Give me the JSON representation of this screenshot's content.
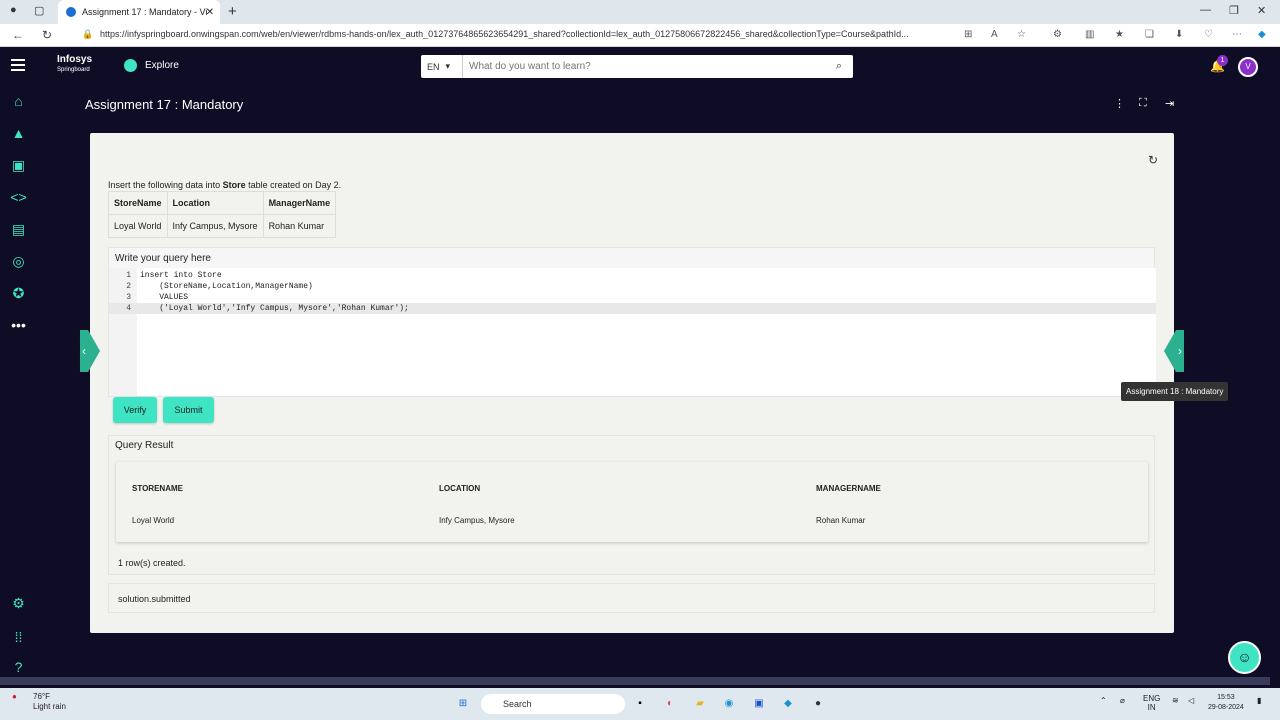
{
  "browser": {
    "tab_title": "Assignment 17 : Mandatory - Vi",
    "url": "https://infyspringboard.onwingspan.com/web/en/viewer/rdbms-hands-on/lex_auth_01273764865623654291_shared?collectionId=lex_auth_01275806672822456_shared&collectionType=Course&pathId..."
  },
  "header": {
    "logo_line1": "Infosys",
    "logo_line2": "Springboard",
    "explore_label": "Explore",
    "lang": "EN",
    "search_placeholder": "What do you want to learn?",
    "notification_count": "1",
    "avatar_initial": "V"
  },
  "page": {
    "title": "Assignment 17 : Mandatory",
    "intro_prefix": "Insert the following data into ",
    "intro_bold": "Store",
    "intro_suffix": " table created on Day 2.",
    "input_table": {
      "headers": [
        "StoreName",
        "Location",
        "ManagerName"
      ],
      "row": [
        "Loyal World",
        "Infy Campus, Mysore",
        "Rohan Kumar"
      ]
    },
    "editor_label": "Write your query here",
    "code_lines": [
      {
        "no": "1",
        "text": "insert into Store"
      },
      {
        "no": "2",
        "text": "    (StoreName,Location,ManagerName)"
      },
      {
        "no": "3",
        "text": "    VALUES"
      },
      {
        "no": "4",
        "text": "    ('Loyal World','Infy Campus, Mysore','Rohan Kumar');"
      }
    ],
    "verify_label": "Verify",
    "submit_label": "Submit",
    "result_label": "Query Result",
    "result_headers": [
      "STORENAME",
      "LOCATION",
      "MANAGERNAME"
    ],
    "result_row": [
      "Loyal World",
      "Infy Campus, Mysore",
      "Rohan Kumar"
    ],
    "rows_message": "1 row(s) created.",
    "solution_message": "solution.submitted",
    "next_tooltip": "Assignment 18 : Mandatory"
  },
  "taskbar": {
    "temp": "76°F",
    "weather": "Light rain",
    "search_label": "Search",
    "lang1": "ENG",
    "lang2": "IN",
    "time": "15:53",
    "date": "29-08-2024"
  }
}
